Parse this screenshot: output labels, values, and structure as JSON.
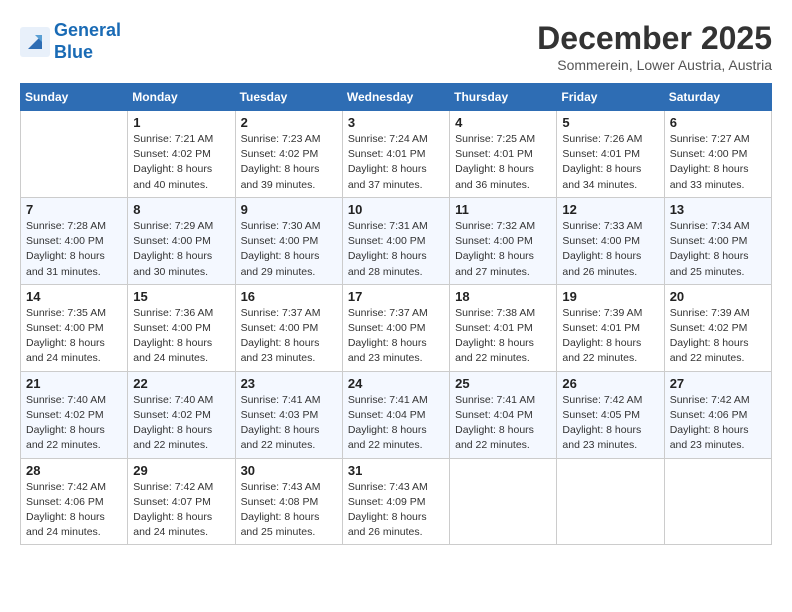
{
  "header": {
    "logo_line1": "General",
    "logo_line2": "Blue",
    "month_title": "December 2025",
    "location": "Sommerein, Lower Austria, Austria"
  },
  "weekdays": [
    "Sunday",
    "Monday",
    "Tuesday",
    "Wednesday",
    "Thursday",
    "Friday",
    "Saturday"
  ],
  "weeks": [
    [
      {
        "day": "",
        "sunrise": "",
        "sunset": "",
        "daylight": ""
      },
      {
        "day": "1",
        "sunrise": "Sunrise: 7:21 AM",
        "sunset": "Sunset: 4:02 PM",
        "daylight": "Daylight: 8 hours and 40 minutes."
      },
      {
        "day": "2",
        "sunrise": "Sunrise: 7:23 AM",
        "sunset": "Sunset: 4:02 PM",
        "daylight": "Daylight: 8 hours and 39 minutes."
      },
      {
        "day": "3",
        "sunrise": "Sunrise: 7:24 AM",
        "sunset": "Sunset: 4:01 PM",
        "daylight": "Daylight: 8 hours and 37 minutes."
      },
      {
        "day": "4",
        "sunrise": "Sunrise: 7:25 AM",
        "sunset": "Sunset: 4:01 PM",
        "daylight": "Daylight: 8 hours and 36 minutes."
      },
      {
        "day": "5",
        "sunrise": "Sunrise: 7:26 AM",
        "sunset": "Sunset: 4:01 PM",
        "daylight": "Daylight: 8 hours and 34 minutes."
      },
      {
        "day": "6",
        "sunrise": "Sunrise: 7:27 AM",
        "sunset": "Sunset: 4:00 PM",
        "daylight": "Daylight: 8 hours and 33 minutes."
      }
    ],
    [
      {
        "day": "7",
        "sunrise": "Sunrise: 7:28 AM",
        "sunset": "Sunset: 4:00 PM",
        "daylight": "Daylight: 8 hours and 31 minutes."
      },
      {
        "day": "8",
        "sunrise": "Sunrise: 7:29 AM",
        "sunset": "Sunset: 4:00 PM",
        "daylight": "Daylight: 8 hours and 30 minutes."
      },
      {
        "day": "9",
        "sunrise": "Sunrise: 7:30 AM",
        "sunset": "Sunset: 4:00 PM",
        "daylight": "Daylight: 8 hours and 29 minutes."
      },
      {
        "day": "10",
        "sunrise": "Sunrise: 7:31 AM",
        "sunset": "Sunset: 4:00 PM",
        "daylight": "Daylight: 8 hours and 28 minutes."
      },
      {
        "day": "11",
        "sunrise": "Sunrise: 7:32 AM",
        "sunset": "Sunset: 4:00 PM",
        "daylight": "Daylight: 8 hours and 27 minutes."
      },
      {
        "day": "12",
        "sunrise": "Sunrise: 7:33 AM",
        "sunset": "Sunset: 4:00 PM",
        "daylight": "Daylight: 8 hours and 26 minutes."
      },
      {
        "day": "13",
        "sunrise": "Sunrise: 7:34 AM",
        "sunset": "Sunset: 4:00 PM",
        "daylight": "Daylight: 8 hours and 25 minutes."
      }
    ],
    [
      {
        "day": "14",
        "sunrise": "Sunrise: 7:35 AM",
        "sunset": "Sunset: 4:00 PM",
        "daylight": "Daylight: 8 hours and 24 minutes."
      },
      {
        "day": "15",
        "sunrise": "Sunrise: 7:36 AM",
        "sunset": "Sunset: 4:00 PM",
        "daylight": "Daylight: 8 hours and 24 minutes."
      },
      {
        "day": "16",
        "sunrise": "Sunrise: 7:37 AM",
        "sunset": "Sunset: 4:00 PM",
        "daylight": "Daylight: 8 hours and 23 minutes."
      },
      {
        "day": "17",
        "sunrise": "Sunrise: 7:37 AM",
        "sunset": "Sunset: 4:00 PM",
        "daylight": "Daylight: 8 hours and 23 minutes."
      },
      {
        "day": "18",
        "sunrise": "Sunrise: 7:38 AM",
        "sunset": "Sunset: 4:01 PM",
        "daylight": "Daylight: 8 hours and 22 minutes."
      },
      {
        "day": "19",
        "sunrise": "Sunrise: 7:39 AM",
        "sunset": "Sunset: 4:01 PM",
        "daylight": "Daylight: 8 hours and 22 minutes."
      },
      {
        "day": "20",
        "sunrise": "Sunrise: 7:39 AM",
        "sunset": "Sunset: 4:02 PM",
        "daylight": "Daylight: 8 hours and 22 minutes."
      }
    ],
    [
      {
        "day": "21",
        "sunrise": "Sunrise: 7:40 AM",
        "sunset": "Sunset: 4:02 PM",
        "daylight": "Daylight: 8 hours and 22 minutes."
      },
      {
        "day": "22",
        "sunrise": "Sunrise: 7:40 AM",
        "sunset": "Sunset: 4:02 PM",
        "daylight": "Daylight: 8 hours and 22 minutes."
      },
      {
        "day": "23",
        "sunrise": "Sunrise: 7:41 AM",
        "sunset": "Sunset: 4:03 PM",
        "daylight": "Daylight: 8 hours and 22 minutes."
      },
      {
        "day": "24",
        "sunrise": "Sunrise: 7:41 AM",
        "sunset": "Sunset: 4:04 PM",
        "daylight": "Daylight: 8 hours and 22 minutes."
      },
      {
        "day": "25",
        "sunrise": "Sunrise: 7:41 AM",
        "sunset": "Sunset: 4:04 PM",
        "daylight": "Daylight: 8 hours and 22 minutes."
      },
      {
        "day": "26",
        "sunrise": "Sunrise: 7:42 AM",
        "sunset": "Sunset: 4:05 PM",
        "daylight": "Daylight: 8 hours and 23 minutes."
      },
      {
        "day": "27",
        "sunrise": "Sunrise: 7:42 AM",
        "sunset": "Sunset: 4:06 PM",
        "daylight": "Daylight: 8 hours and 23 minutes."
      }
    ],
    [
      {
        "day": "28",
        "sunrise": "Sunrise: 7:42 AM",
        "sunset": "Sunset: 4:06 PM",
        "daylight": "Daylight: 8 hours and 24 minutes."
      },
      {
        "day": "29",
        "sunrise": "Sunrise: 7:42 AM",
        "sunset": "Sunset: 4:07 PM",
        "daylight": "Daylight: 8 hours and 24 minutes."
      },
      {
        "day": "30",
        "sunrise": "Sunrise: 7:43 AM",
        "sunset": "Sunset: 4:08 PM",
        "daylight": "Daylight: 8 hours and 25 minutes."
      },
      {
        "day": "31",
        "sunrise": "Sunrise: 7:43 AM",
        "sunset": "Sunset: 4:09 PM",
        "daylight": "Daylight: 8 hours and 26 minutes."
      },
      {
        "day": "",
        "sunrise": "",
        "sunset": "",
        "daylight": ""
      },
      {
        "day": "",
        "sunrise": "",
        "sunset": "",
        "daylight": ""
      },
      {
        "day": "",
        "sunrise": "",
        "sunset": "",
        "daylight": ""
      }
    ]
  ]
}
